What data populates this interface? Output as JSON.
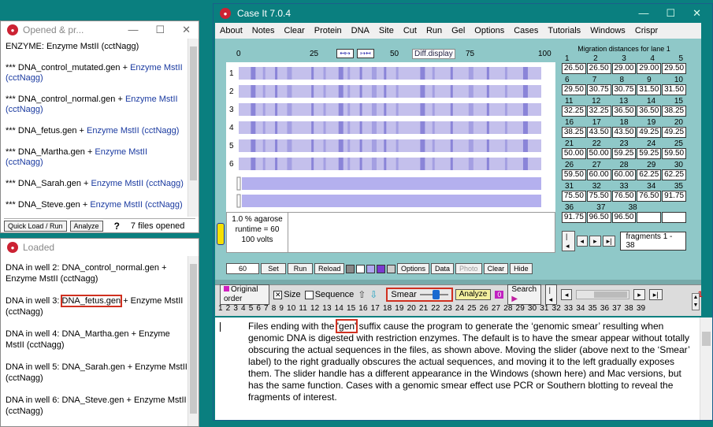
{
  "opened_window": {
    "title": "Opened & pr...",
    "lines": [
      {
        "text": "ENZYME: Enzyme MstII (cctNagg)",
        "suffix": ""
      },
      {
        "text": "*** DNA_control_mutated.gen + ",
        "suffix": "Enzyme MstII (cctNagg)"
      },
      {
        "text": "*** DNA_control_normal.gen + ",
        "suffix": "Enzyme MstII (cctNagg)"
      },
      {
        "text": "*** DNA_fetus.gen + ",
        "suffix": "Enzyme MstII (cctNagg)"
      },
      {
        "text": "*** DNA_Martha.gen + ",
        "suffix": "Enzyme MstII (cctNagg)"
      },
      {
        "text": "*** DNA_Sarah.gen + ",
        "suffix": "Enzyme MstII (cctNagg)"
      },
      {
        "text": "*** DNA_Steve.gen + ",
        "suffix": "Enzyme MstII (cctNagg)"
      }
    ],
    "quick_load": "Quick Load / Run",
    "analyze": "Analyze",
    "help": "?",
    "files_opened": "7  files opened"
  },
  "loaded_window": {
    "title": "Loaded",
    "lines": [
      {
        "pre": "DNA in well 2:  ",
        "name": "DNA_control_normal.gen",
        "post": " + Enzyme MstII (cctNagg)"
      },
      {
        "pre": "DNA in well 3:  ",
        "name": "DNA_fetus.gen",
        "post": " + Enzyme MstII (cctNagg)"
      },
      {
        "pre": "DNA in well 4:  ",
        "name": "DNA_Martha.gen",
        "post": " + Enzyme MstII (cctNagg)"
      },
      {
        "pre": "DNA in well 5:  ",
        "name": "DNA_Sarah.gen",
        "post": " + Enzyme MstII (cctNagg)"
      },
      {
        "pre": "DNA in well 6:  ",
        "name": "DNA_Steve.gen",
        "post": " + Enzyme MstII (cctNagg)"
      }
    ]
  },
  "main_window": {
    "title": "Case It 7.0.4",
    "menu": [
      "About",
      "Notes",
      "Clear",
      "Protein",
      "DNA",
      "Site",
      "Cut",
      "Run",
      "Gel",
      "Options",
      "Cases",
      "Tutorials",
      "Windows",
      "Crispr"
    ],
    "ruler": [
      "0",
      "25",
      "50",
      "75",
      "100"
    ],
    "diff_display": "Diff.display",
    "lanes": [
      "1",
      "2",
      "3",
      "4",
      "5",
      "6"
    ],
    "gel_info": {
      "agarose": "1.0 % agarose",
      "runtime": "runtime = 60",
      "volts": "100 volts"
    },
    "gel_buttons": {
      "value": "60",
      "set": "Set",
      "run": "Run",
      "reload": "Reload",
      "options": "Options",
      "data": "Data",
      "photo": "Photo",
      "clear": "Clear",
      "hide": "Hide"
    },
    "migration": {
      "title": "Migration distances for lane 1",
      "blocks": [
        {
          "nums": [
            "1",
            "2",
            "3",
            "4",
            "5"
          ],
          "vals": [
            "26.50",
            "26.50",
            "29.00",
            "29.00",
            "29.50"
          ]
        },
        {
          "nums": [
            "6",
            "7",
            "8",
            "9",
            "10"
          ],
          "vals": [
            "29.50",
            "30.75",
            "30.75",
            "31.50",
            "31.50"
          ]
        },
        {
          "nums": [
            "11",
            "12",
            "13",
            "14",
            "15"
          ],
          "vals": [
            "32.25",
            "32.25",
            "36.50",
            "36.50",
            "38.25"
          ]
        },
        {
          "nums": [
            "16",
            "17",
            "18",
            "19",
            "20"
          ],
          "vals": [
            "38.25",
            "43.50",
            "43.50",
            "49.25",
            "49.25"
          ]
        },
        {
          "nums": [
            "21",
            "22",
            "23",
            "24",
            "25"
          ],
          "vals": [
            "50.00",
            "50.00",
            "59.25",
            "59.25",
            "59.50"
          ]
        },
        {
          "nums": [
            "26",
            "27",
            "28",
            "29",
            "30"
          ],
          "vals": [
            "59.50",
            "60.00",
            "60.00",
            "62.25",
            "62.25"
          ]
        },
        {
          "nums": [
            "31",
            "32",
            "33",
            "34",
            "35"
          ],
          "vals": [
            "75.50",
            "75.50",
            "76.50",
            "76.50",
            "91.75"
          ]
        },
        {
          "nums": [
            "36",
            "37",
            "38",
            "",
            ""
          ],
          "vals": [
            "91.75",
            "96.50",
            "96.50",
            "",
            ""
          ]
        }
      ],
      "fragments": "fragments 1 - 38"
    },
    "toolbar": {
      "original_order": "Original order",
      "size": "Size",
      "sequence": "Sequence",
      "smear": "Smear",
      "analyze": "Analyze",
      "zero": "0",
      "search": "Search",
      "counter": "1",
      "numbers": [
        "1",
        "2",
        "3",
        "4",
        "5",
        "6",
        "7",
        "8",
        "9",
        "10",
        "11",
        "12",
        "13",
        "14",
        "15",
        "16",
        "17",
        "18",
        "19",
        "20",
        "21",
        "22",
        "23",
        "24",
        "25",
        "26",
        "27",
        "28",
        "29",
        "30",
        "31",
        "32",
        "33",
        "34",
        "35",
        "36",
        "37",
        "38",
        "39"
      ]
    },
    "text": {
      "before": "Files ending with the ",
      "highlight": "'gen'",
      "after": " suffix cause the program to generate the ‘genomic smear’ resulting when genomic DNA is digested with restriction enzymes.  The default is to have the smear appear without totally obscuring the actual sequences in the files, as shown above.  Moving the slider (above next to the ‘Smear’ label) to the right gradually obscures the actual sequences, and moving it to the left gradually exposes them.  The slider handle has a different appearance in the Windows (shown here) and Mac versions, but has the same function.  Cases with a genomic smear effect use PCR or Southern blotting to reveal the fragments of interest."
    }
  }
}
